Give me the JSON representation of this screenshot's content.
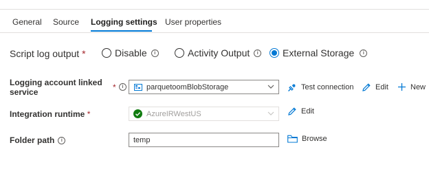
{
  "tabs": [
    {
      "label": "General"
    },
    {
      "label": "Source"
    },
    {
      "label": "Logging settings"
    },
    {
      "label": "User properties"
    }
  ],
  "active_tab": "Logging settings",
  "script_log_output": {
    "label": "Script log output",
    "required_mark": "*",
    "options": [
      {
        "label": "Disable",
        "checked": false
      },
      {
        "label": "Activity Output",
        "checked": false
      },
      {
        "label": "External Storage",
        "checked": true
      }
    ]
  },
  "logging_account": {
    "label_line1": "Logging account linked",
    "label_line2": "service",
    "required_mark": "*",
    "value": "parquetoomBlobStorage",
    "actions": {
      "test_connection": "Test connection",
      "edit": "Edit",
      "new": "New"
    }
  },
  "integration_runtime": {
    "label": "Integration runtime",
    "required_mark": "*",
    "value": "AzureIRWestUS",
    "edit": "Edit"
  },
  "folder_path": {
    "label": "Folder path",
    "value": "temp",
    "browse": "Browse"
  },
  "colors": {
    "accent": "#0078d4",
    "required": "#a4262c",
    "success": "#107c10"
  }
}
